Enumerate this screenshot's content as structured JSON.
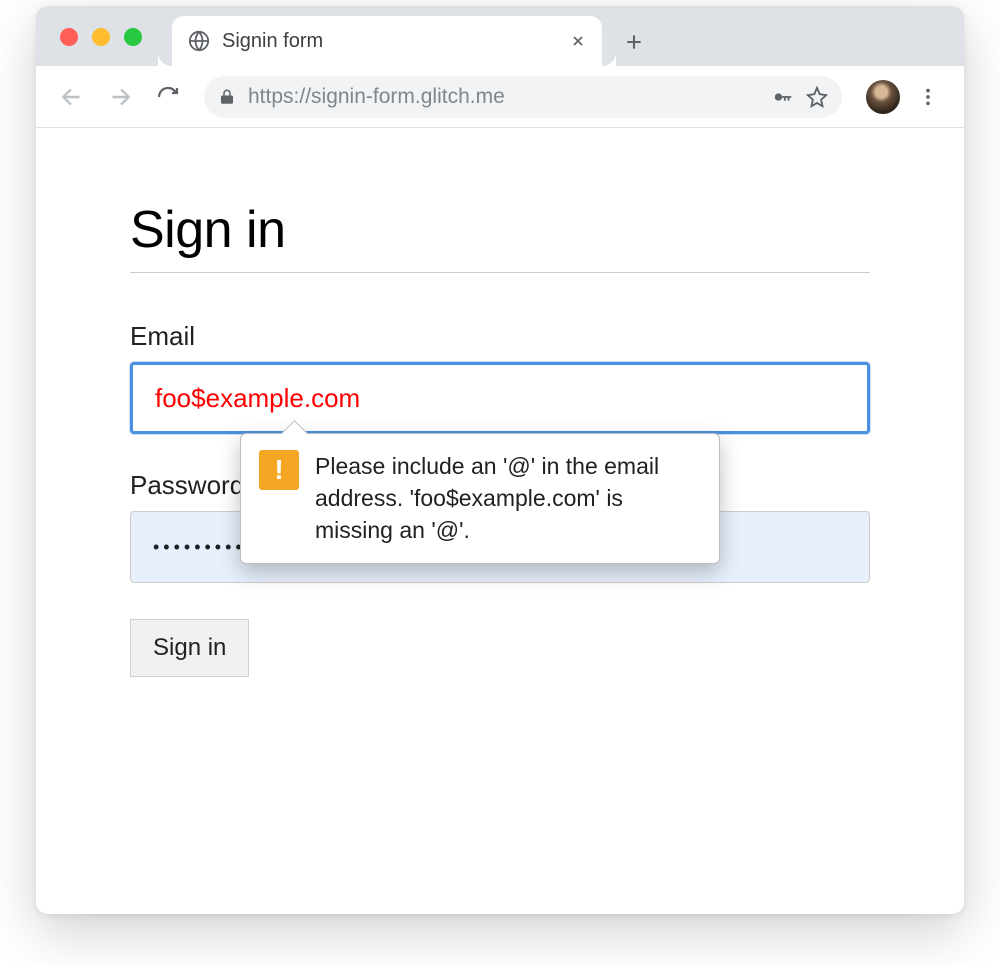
{
  "browser": {
    "tab_title": "Signin form",
    "url": "https://signin-form.glitch.me"
  },
  "page": {
    "heading": "Sign in",
    "email_label": "Email",
    "email_value": "foo$example.com",
    "password_label": "Password",
    "password_value": "•••••••••••",
    "submit_label": "Sign in"
  },
  "validation": {
    "icon_glyph": "!",
    "message": "Please include an '@' in the email address. 'foo$example.com' is missing an '@'."
  }
}
